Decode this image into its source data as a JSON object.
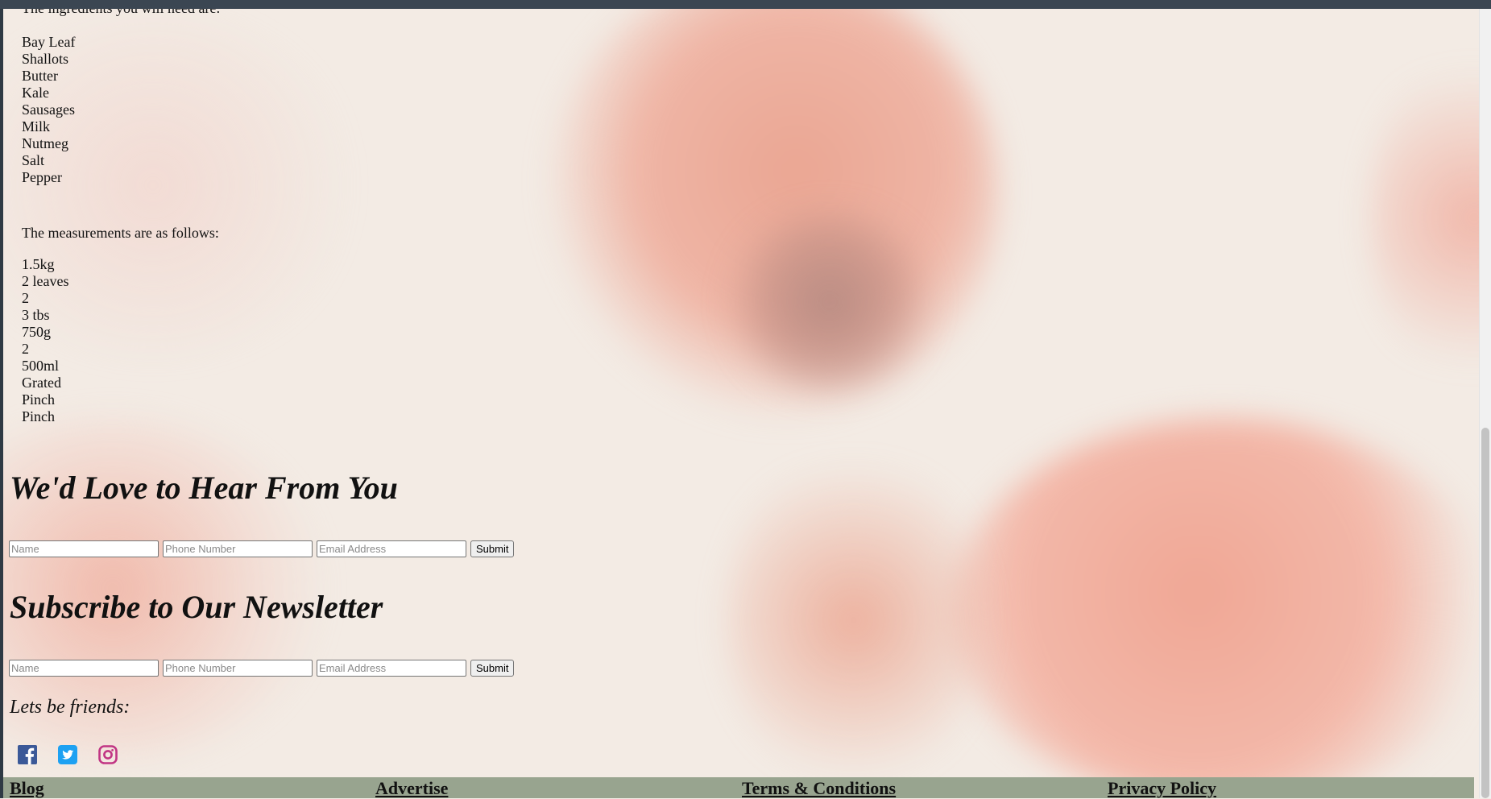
{
  "recipe": {
    "ingredients_intro": "The ingredients you will need are:",
    "ingredients": [
      "Bay Leaf",
      "Shallots",
      "Butter",
      "Kale",
      "Sausages",
      "Milk",
      "Nutmeg",
      "Salt",
      "Pepper"
    ],
    "measurements_intro": "The measurements are as follows:",
    "measurements": [
      "1.5kg",
      "2 leaves",
      "2",
      "3 tbs",
      "750g",
      "2",
      "500ml",
      "Grated",
      "Pinch",
      "Pinch"
    ]
  },
  "contact": {
    "heading": "We'd Love to Hear From You",
    "name_placeholder": "Name",
    "phone_placeholder": "Phone Number",
    "email_placeholder": "Email Address",
    "submit_label": "Submit"
  },
  "newsletter": {
    "heading": "Subscribe to Our Newsletter",
    "name_placeholder": "Name",
    "phone_placeholder": "Phone Number",
    "email_placeholder": "Email Address",
    "submit_label": "Submit"
  },
  "social": {
    "label": "Lets be friends:",
    "icons": [
      "facebook-icon",
      "twitter-icon",
      "instagram-icon"
    ],
    "colors": {
      "facebook": "#3b5998",
      "twitter": "#1da1f2",
      "instagram": "#c13584"
    }
  },
  "footer": {
    "links": [
      "Blog",
      "Advertise",
      "Terms & Conditions",
      "Privacy Policy"
    ],
    "background": "#98a48f"
  }
}
